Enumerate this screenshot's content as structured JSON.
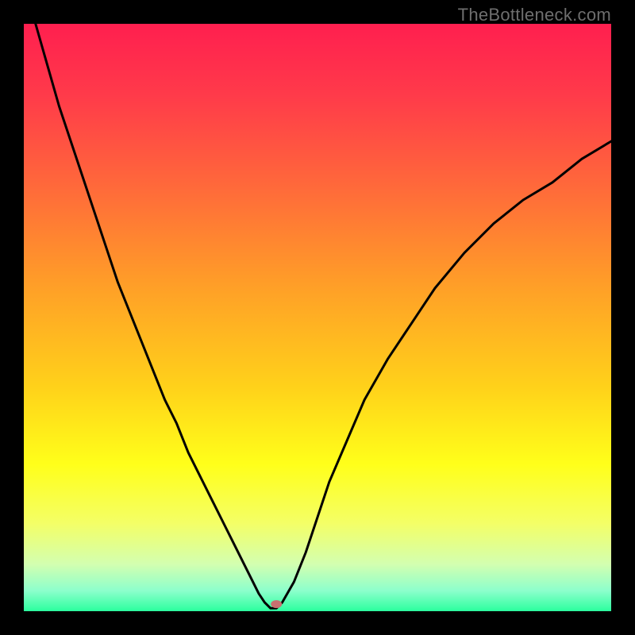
{
  "watermark": "TheBottleneck.com",
  "chart_data": {
    "type": "line",
    "title": "",
    "xlabel": "",
    "ylabel": "",
    "xlim": [
      0,
      100
    ],
    "ylim": [
      0,
      100
    ],
    "optimum_x": 42,
    "marker": {
      "x": 43,
      "y": 1.2,
      "color": "#c87070",
      "rx": 7,
      "ry": 5
    },
    "gradient_stops": [
      {
        "offset": 0.0,
        "color": "#ff1f4f"
      },
      {
        "offset": 0.12,
        "color": "#ff3a4a"
      },
      {
        "offset": 0.28,
        "color": "#ff6a3a"
      },
      {
        "offset": 0.45,
        "color": "#ffa027"
      },
      {
        "offset": 0.62,
        "color": "#ffd21a"
      },
      {
        "offset": 0.75,
        "color": "#ffff1a"
      },
      {
        "offset": 0.85,
        "color": "#f4ff66"
      },
      {
        "offset": 0.92,
        "color": "#d3ffb0"
      },
      {
        "offset": 0.965,
        "color": "#8dffcc"
      },
      {
        "offset": 1.0,
        "color": "#2bff9e"
      }
    ],
    "series": [
      {
        "name": "bottleneck-curve",
        "x": [
          0,
          2,
          4,
          6,
          8,
          10,
          12,
          14,
          16,
          18,
          20,
          22,
          24,
          26,
          28,
          30,
          32,
          34,
          36,
          38,
          40,
          41,
          42,
          43,
          44,
          46,
          48,
          50,
          52,
          55,
          58,
          62,
          66,
          70,
          75,
          80,
          85,
          90,
          95,
          100
        ],
        "y": [
          107,
          100,
          93,
          86,
          80,
          74,
          68,
          62,
          56,
          51,
          46,
          41,
          36,
          32,
          27,
          23,
          19,
          15,
          11,
          7,
          3,
          1.5,
          0.5,
          0.5,
          1.5,
          5,
          10,
          16,
          22,
          29,
          36,
          43,
          49,
          55,
          61,
          66,
          70,
          73,
          77,
          80
        ]
      }
    ]
  }
}
